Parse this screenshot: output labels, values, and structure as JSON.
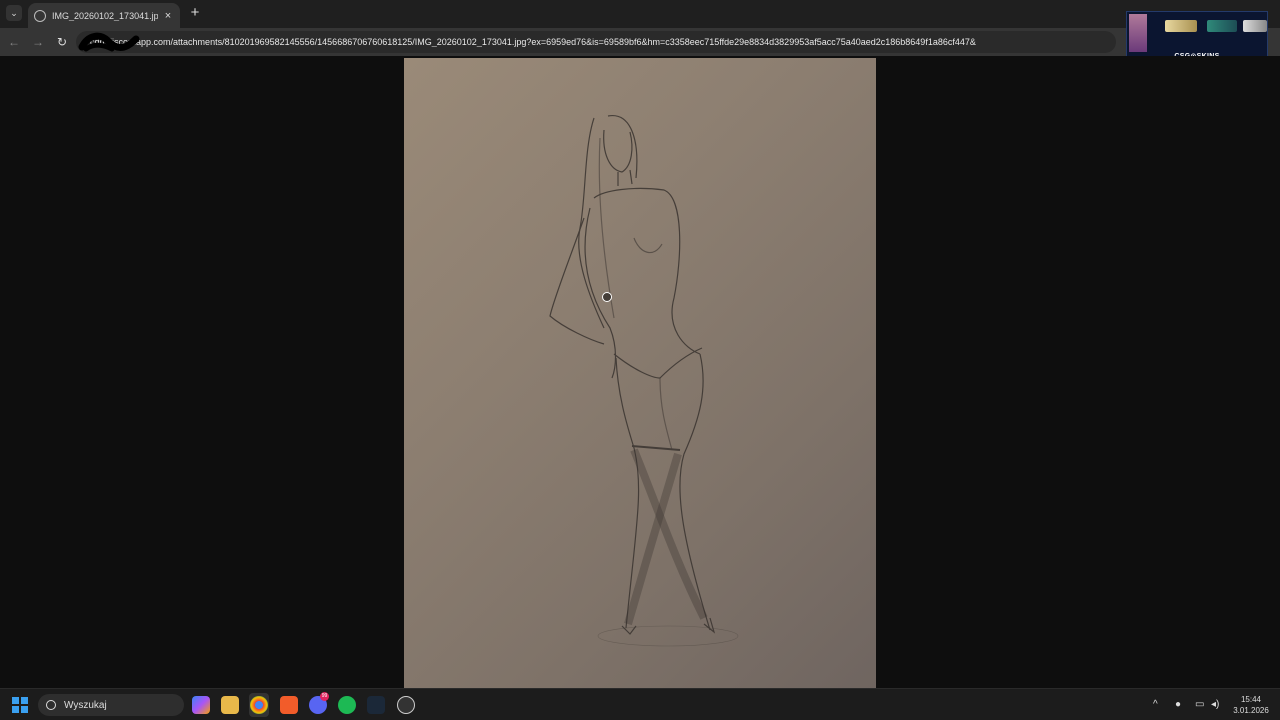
{
  "browser": {
    "tab_title": "IMG_20260102_173041.jpg (30...",
    "url_visible": "cdn.discordapp.com/attachments/810201969582145556/1456686706760618125/IMG_20260102_173041.jpg?ex=6959ed76&is=69589bf6&hm=c3358eec715ffde29e8834d3829953af5acc75a40aed2c186b8649f1a86cf447&",
    "new_tab": "+",
    "close": "×",
    "back": "←",
    "forward": "→",
    "reload": "↻",
    "tab_menu": "⌄"
  },
  "overlay": {
    "label": "CSG⊙SKINS"
  },
  "taskbar": {
    "search_placeholder": "Wyszukaj",
    "discord_badge": "99",
    "time": "15:44",
    "date": "3.01.2026"
  },
  "colors": {
    "accent_blue": "#3aa0f0",
    "chrome_dark": "#1f1f1f",
    "paper": "#8d7f71"
  }
}
